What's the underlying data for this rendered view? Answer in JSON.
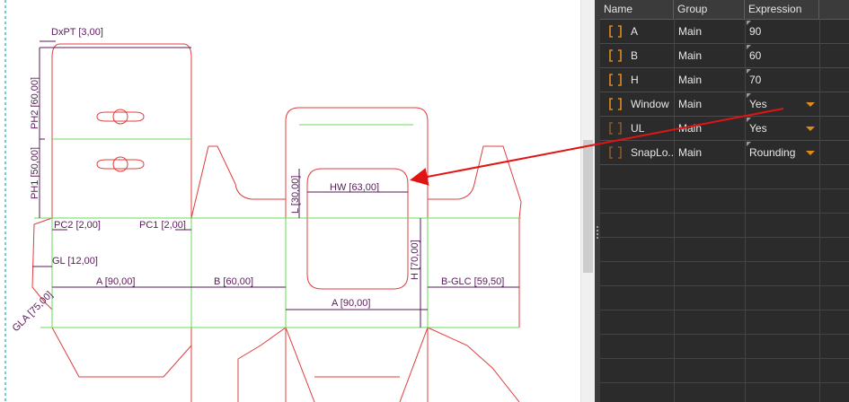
{
  "drawing": {
    "dims": {
      "dxpt": "DxPT [3,00]",
      "ph2": "PH2 [60,00]",
      "ph1": "PH1 [50,00]",
      "pc2": "PC2 [2,00]",
      "pc1": "PC1 [2,00]",
      "gl": "GL [12,00]",
      "a_left": "A [90,00]",
      "b": "B [60,00]",
      "gla": "GLA [75,00]",
      "hw": "HW [63,00]",
      "l": "L [30,00]",
      "h": "H [70,00]",
      "a_mid": "A [90,00]",
      "bglc": "B-GLC [59,50]"
    },
    "colors": {
      "cut": "#e03c3c",
      "crease": "#66dd55",
      "dimension": "#5a1a5a",
      "guide": "#008b8b"
    }
  },
  "properties": {
    "columns": {
      "name": "Name",
      "group": "Group",
      "expression": "Expression"
    },
    "rows": [
      {
        "name": "A",
        "group": "Main",
        "expression": "90",
        "icon": "bracket-icon",
        "dropdown": false
      },
      {
        "name": "B",
        "group": "Main",
        "expression": "60",
        "icon": "bracket-icon",
        "dropdown": false
      },
      {
        "name": "H",
        "group": "Main",
        "expression": "70",
        "icon": "bracket-icon",
        "dropdown": false
      },
      {
        "name": "Window",
        "group": "Main",
        "expression": "Yes",
        "icon": "bracket-icon",
        "dropdown": true
      },
      {
        "name": "UL",
        "group": "Main",
        "expression": "Yes",
        "icon": "bracket-icon",
        "dropdown": true
      },
      {
        "name": "SnapLo...",
        "group": "Main",
        "expression": "Rounding",
        "icon": "bracket-icon",
        "dropdown": true
      }
    ],
    "accent": "#e08a1e",
    "annotation_color": "#e01414"
  }
}
